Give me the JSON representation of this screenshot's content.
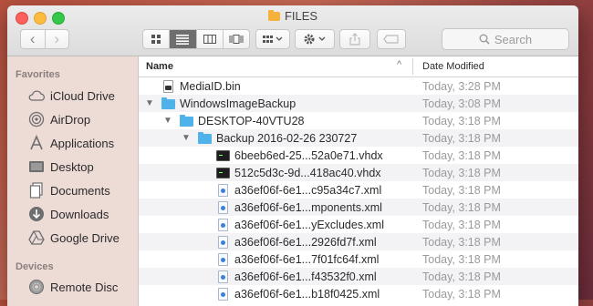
{
  "window": {
    "title": "FILES"
  },
  "toolbar": {
    "back_glyph": "‹",
    "forward_glyph": "›",
    "views": [
      "icon-view",
      "list-view",
      "column-view",
      "cover-flow-view"
    ],
    "active_view": "list-view",
    "search_placeholder": "Search"
  },
  "sidebar": {
    "sections": [
      {
        "heading": "Favorites",
        "items": [
          {
            "label": "iCloud Drive",
            "icon": "cloud-icon"
          },
          {
            "label": "AirDrop",
            "icon": "airdrop-icon"
          },
          {
            "label": "Applications",
            "icon": "applications-icon"
          },
          {
            "label": "Desktop",
            "icon": "desktop-icon"
          },
          {
            "label": "Documents",
            "icon": "documents-icon"
          },
          {
            "label": "Downloads",
            "icon": "downloads-icon"
          },
          {
            "label": "Google Drive",
            "icon": "google-drive-icon"
          }
        ]
      },
      {
        "heading": "Devices",
        "items": [
          {
            "label": "Remote Disc",
            "icon": "disc-icon"
          }
        ]
      }
    ]
  },
  "list": {
    "columns": {
      "name": "Name",
      "date": "Date Modified",
      "sort_indicator": "^"
    },
    "rows": [
      {
        "name": "MediaID.bin",
        "date": "Today, 3:28 PM",
        "depth": 0,
        "type": "bin"
      },
      {
        "name": "WindowsImageBackup",
        "date": "Today, 3:08 PM",
        "depth": 0,
        "type": "folder",
        "expanded": true
      },
      {
        "name": "DESKTOP-40VTU28",
        "date": "Today, 3:18 PM",
        "depth": 1,
        "type": "folder",
        "expanded": true
      },
      {
        "name": "Backup 2016-02-26 230727",
        "date": "Today, 3:18 PM",
        "depth": 2,
        "type": "folder",
        "expanded": true
      },
      {
        "name": "6beeb6ed-25...52a0e71.vhdx",
        "date": "Today, 3:18 PM",
        "depth": 3,
        "type": "vhdx"
      },
      {
        "name": "512c5d3c-9d...418ac40.vhdx",
        "date": "Today, 3:18 PM",
        "depth": 3,
        "type": "vhdx"
      },
      {
        "name": "a36ef06f-6e1...c95a34c7.xml",
        "date": "Today, 3:18 PM",
        "depth": 3,
        "type": "xml"
      },
      {
        "name": "a36ef06f-6e1...mponents.xml",
        "date": "Today, 3:18 PM",
        "depth": 3,
        "type": "xml"
      },
      {
        "name": "a36ef06f-6e1...yExcludes.xml",
        "date": "Today, 3:18 PM",
        "depth": 3,
        "type": "xml"
      },
      {
        "name": "a36ef06f-6e1...2926fd7f.xml",
        "date": "Today, 3:18 PM",
        "depth": 3,
        "type": "xml"
      },
      {
        "name": "a36ef06f-6e1...7f01fc64f.xml",
        "date": "Today, 3:18 PM",
        "depth": 3,
        "type": "xml"
      },
      {
        "name": "a36ef06f-6e1...f43532f0.xml",
        "date": "Today, 3:18 PM",
        "depth": 3,
        "type": "xml"
      },
      {
        "name": "a36ef06f-6e1...b18f0425.xml",
        "date": "Today, 3:18 PM",
        "depth": 3,
        "type": "xml"
      }
    ]
  },
  "colors": {
    "folder": "#4fb2ea",
    "selected_view": "#6e6e6e",
    "sidebar_bg": "#ecdad4"
  }
}
